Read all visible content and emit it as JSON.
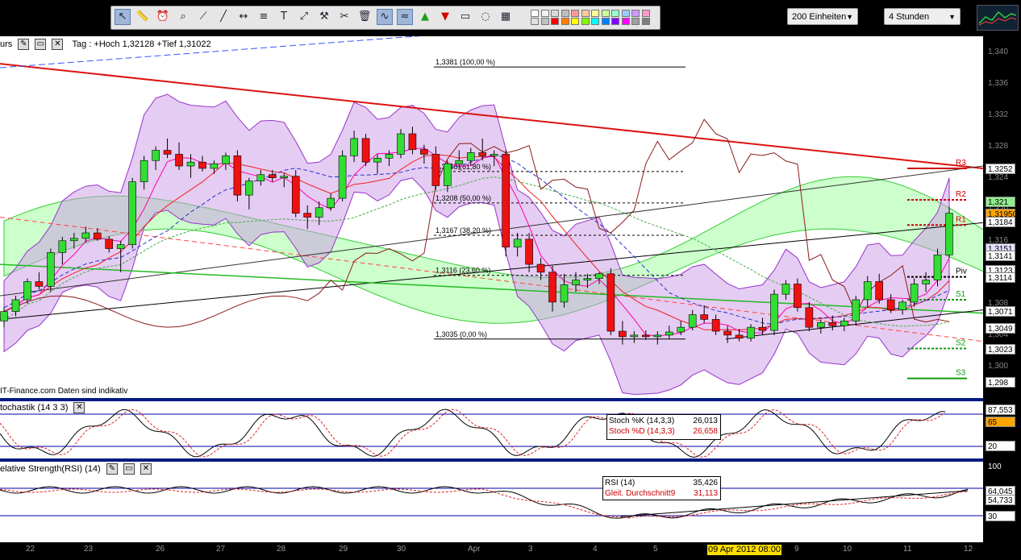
{
  "toolbar": {
    "tools": [
      "pointer-icon",
      "ruler-icon",
      "alarm-icon",
      "zoom-icon",
      "trendline-icon",
      "ray-icon",
      "horizontal-line-icon",
      "fib-icon",
      "text-icon",
      "arrow-icon",
      "settings-icon",
      "tools-icon",
      "trash-icon",
      "indicator-icon",
      "overlay-icon",
      "buy-arrow-icon",
      "sell-arrow-icon",
      "rectangle-icon",
      "lasso-icon",
      "grid-icon"
    ],
    "colors": [
      "#ffffff",
      "#f2f2f2",
      "#d9d9d9",
      "#bfbfbf",
      "#ff9999",
      "#ffcc99",
      "#ffff99",
      "#ccff99",
      "#99ffcc",
      "#99ccff",
      "#cc99ff",
      "#ff99cc",
      "#e0e0e0",
      "#c0c0c0",
      "#ff0000",
      "#ff8000",
      "#ffff00",
      "#80ff00",
      "#00ffff",
      "#0080ff",
      "#8000ff",
      "#ff00ff",
      "#a0a0a0",
      "#808080"
    ],
    "units_label": "200 Einheiten",
    "timeframe_label": "4 Stunden"
  },
  "price_panel": {
    "title_partial": "urs",
    "info_text": "Tag : +Hoch 1,32128 +Tief 1,31022",
    "watermark": "IT-Finance.com  Daten sind indikativ",
    "fib_labels": [
      "1,3381 (100,00 %)",
      "1,3248 (61,80 %)",
      "1,3208 (50,00 %)",
      "1,3167 (38,20 %)",
      "1,3116 (23,60 %)",
      "1,3035 (0,00 %)"
    ],
    "pivot_labels": [
      "R3",
      "R2",
      "R1",
      "Piv",
      "S1",
      "S2",
      "S3"
    ],
    "axis_ticks": [
      "1,340",
      "1,336",
      "1,332",
      "1,328",
      "1,324",
      "1,320",
      "1,316",
      "1,312",
      "1,308",
      "1,304",
      "1,300"
    ],
    "axis_tags": [
      {
        "text": "1,3252",
        "color": "#ffffff"
      },
      {
        "text": "1,321",
        "color": "#90ee90"
      },
      {
        "text": "1,31950",
        "color": "#ffa500"
      },
      {
        "text": "1,3184",
        "color": "#ffffff"
      },
      {
        "text": "1,3151",
        "color": "#e0e0ff"
      },
      {
        "text": "1,3141",
        "color": "#ffffff"
      },
      {
        "text": "1,3123",
        "color": "#ffffff"
      },
      {
        "text": "1,3114",
        "color": "#ffffff"
      },
      {
        "text": "1,3071",
        "color": "#ffffff"
      },
      {
        "text": "1,3049",
        "color": "#ffffff"
      },
      {
        "text": "1,3023",
        "color": "#ffffff"
      },
      {
        "text": "1,298",
        "color": "#ffffff"
      }
    ]
  },
  "stoch_panel": {
    "title": "tochastik (14 3 3)",
    "k_label": "Stoch %K (14,3,3)",
    "k_value": "26,013",
    "d_label": "Stoch %D (14,3,3)",
    "d_value": "26,658",
    "axis_tags": [
      {
        "text": "87,553",
        "color": "#ffffff"
      },
      {
        "text": "65",
        "color": "#ffa500"
      },
      {
        "text": "20",
        "color": "#ffffff"
      }
    ]
  },
  "rsi_panel": {
    "title": "elative Strength(RSI) (14)",
    "rsi_label": "RSI (14)",
    "rsi_value": "35,426",
    "avg_label": "Gleit. Durchschnitt9",
    "avg_value": "31,113",
    "axis_tags": [
      {
        "text": "64,045",
        "color": "#ffffff"
      },
      {
        "text": "54,733",
        "color": "#ffffff"
      },
      {
        "text": "30",
        "color": "#ffffff"
      }
    ],
    "axis_ticks": [
      "100"
    ]
  },
  "x_axis": {
    "labels": [
      "22",
      "23",
      "26",
      "27",
      "28",
      "29",
      "30",
      "Apr",
      "3",
      "4",
      "5",
      "6",
      "9",
      "10",
      "11",
      "12"
    ],
    "highlight": "09 Apr 2012 08:00"
  },
  "chart_data": {
    "type": "candlestick",
    "title": "",
    "ylim": [
      1.296,
      1.342
    ],
    "candles": [
      [
        1.3058,
        1.3075,
        1.305,
        1.307
      ],
      [
        1.307,
        1.309,
        1.3064,
        1.3085
      ],
      [
        1.3085,
        1.3112,
        1.308,
        1.3108
      ],
      [
        1.3108,
        1.312,
        1.3098,
        1.3102
      ],
      [
        1.3102,
        1.315,
        1.3095,
        1.3145
      ],
      [
        1.3145,
        1.3165,
        1.313,
        1.316
      ],
      [
        1.316,
        1.317,
        1.315,
        1.3163
      ],
      [
        1.3163,
        1.3178,
        1.3158,
        1.317
      ],
      [
        1.317,
        1.3176,
        1.316,
        1.3162
      ],
      [
        1.3162,
        1.3166,
        1.3145,
        1.315
      ],
      [
        1.315,
        1.316,
        1.312,
        1.3155
      ],
      [
        1.3155,
        1.324,
        1.315,
        1.3235
      ],
      [
        1.3235,
        1.3268,
        1.3225,
        1.3262
      ],
      [
        1.3262,
        1.328,
        1.325,
        1.3275
      ],
      [
        1.3275,
        1.329,
        1.3265,
        1.327
      ],
      [
        1.327,
        1.3285,
        1.325,
        1.3255
      ],
      [
        1.3255,
        1.327,
        1.324,
        1.326
      ],
      [
        1.326,
        1.3268,
        1.3248,
        1.3252
      ],
      [
        1.3252,
        1.3262,
        1.3245,
        1.3258
      ],
      [
        1.3258,
        1.3272,
        1.325,
        1.3268
      ],
      [
        1.3268,
        1.3275,
        1.321,
        1.3218
      ],
      [
        1.3218,
        1.324,
        1.32,
        1.3236
      ],
      [
        1.3236,
        1.325,
        1.323,
        1.3244
      ],
      [
        1.3244,
        1.325,
        1.3235,
        1.324
      ],
      [
        1.324,
        1.3246,
        1.3228,
        1.3242
      ],
      [
        1.3242,
        1.325,
        1.319,
        1.3195
      ],
      [
        1.3195,
        1.3205,
        1.3175,
        1.319
      ],
      [
        1.319,
        1.321,
        1.318,
        1.3202
      ],
      [
        1.3202,
        1.322,
        1.3198,
        1.3214
      ],
      [
        1.3214,
        1.3275,
        1.321,
        1.3268
      ],
      [
        1.3268,
        1.33,
        1.326,
        1.329
      ],
      [
        1.329,
        1.3296,
        1.3255,
        1.326
      ],
      [
        1.326,
        1.327,
        1.3245,
        1.3265
      ],
      [
        1.3265,
        1.3275,
        1.3255,
        1.327
      ],
      [
        1.327,
        1.3302,
        1.3265,
        1.3296
      ],
      [
        1.3296,
        1.3305,
        1.327,
        1.3276
      ],
      [
        1.3276,
        1.3282,
        1.3258,
        1.327
      ],
      [
        1.327,
        1.328,
        1.3225,
        1.323
      ],
      [
        1.323,
        1.3262,
        1.3222,
        1.3258
      ],
      [
        1.3258,
        1.3275,
        1.325,
        1.3262
      ],
      [
        1.3262,
        1.3278,
        1.3255,
        1.3272
      ],
      [
        1.3272,
        1.329,
        1.3262,
        1.3268
      ],
      [
        1.3268,
        1.3275,
        1.3255,
        1.327
      ],
      [
        1.327,
        1.3275,
        1.314,
        1.3152
      ],
      [
        1.3152,
        1.317,
        1.314,
        1.3162
      ],
      [
        1.3162,
        1.317,
        1.312,
        1.313
      ],
      [
        1.313,
        1.3138,
        1.311,
        1.312
      ],
      [
        1.312,
        1.3128,
        1.307,
        1.3082
      ],
      [
        1.3082,
        1.3118,
        1.3075,
        1.3104
      ],
      [
        1.3104,
        1.312,
        1.3095,
        1.311
      ],
      [
        1.311,
        1.3118,
        1.31,
        1.3112
      ],
      [
        1.3112,
        1.312,
        1.3105,
        1.3118
      ],
      [
        1.3118,
        1.3125,
        1.304,
        1.3045
      ],
      [
        1.3045,
        1.3058,
        1.3028,
        1.3038
      ],
      [
        1.3038,
        1.3045,
        1.303,
        1.304
      ],
      [
        1.304,
        1.3046,
        1.3034,
        1.3038
      ],
      [
        1.3038,
        1.3045,
        1.3028,
        1.304
      ],
      [
        1.304,
        1.3052,
        1.3035,
        1.3044
      ],
      [
        1.3044,
        1.3058,
        1.304,
        1.305
      ],
      [
        1.305,
        1.3072,
        1.3046,
        1.3066
      ],
      [
        1.3066,
        1.3078,
        1.3055,
        1.306
      ],
      [
        1.306,
        1.3066,
        1.304,
        1.3045
      ],
      [
        1.3045,
        1.3052,
        1.303,
        1.304
      ],
      [
        1.304,
        1.3048,
        1.3032,
        1.3036
      ],
      [
        1.3036,
        1.3054,
        1.3032,
        1.305
      ],
      [
        1.305,
        1.3062,
        1.304,
        1.3046
      ],
      [
        1.3046,
        1.3098,
        1.304,
        1.3092
      ],
      [
        1.3092,
        1.311,
        1.3085,
        1.3105
      ],
      [
        1.3105,
        1.3112,
        1.307,
        1.3075
      ],
      [
        1.3075,
        1.3082,
        1.3045,
        1.305
      ],
      [
        1.305,
        1.306,
        1.3042,
        1.3056
      ],
      [
        1.3056,
        1.3065,
        1.3046,
        1.3052
      ],
      [
        1.3052,
        1.3062,
        1.3045,
        1.3058
      ],
      [
        1.3058,
        1.309,
        1.3052,
        1.3085
      ],
      [
        1.3085,
        1.3115,
        1.3075,
        1.3108
      ],
      [
        1.3108,
        1.3118,
        1.308,
        1.3085
      ],
      [
        1.3085,
        1.3092,
        1.3068,
        1.3072
      ],
      [
        1.3072,
        1.3085,
        1.3066,
        1.3082
      ],
      [
        1.3082,
        1.3112,
        1.3076,
        1.3105
      ],
      [
        1.3105,
        1.312,
        1.3095,
        1.311
      ],
      [
        1.311,
        1.315,
        1.3102,
        1.3142
      ],
      [
        1.3142,
        1.3203,
        1.3138,
        1.3195
      ]
    ]
  }
}
